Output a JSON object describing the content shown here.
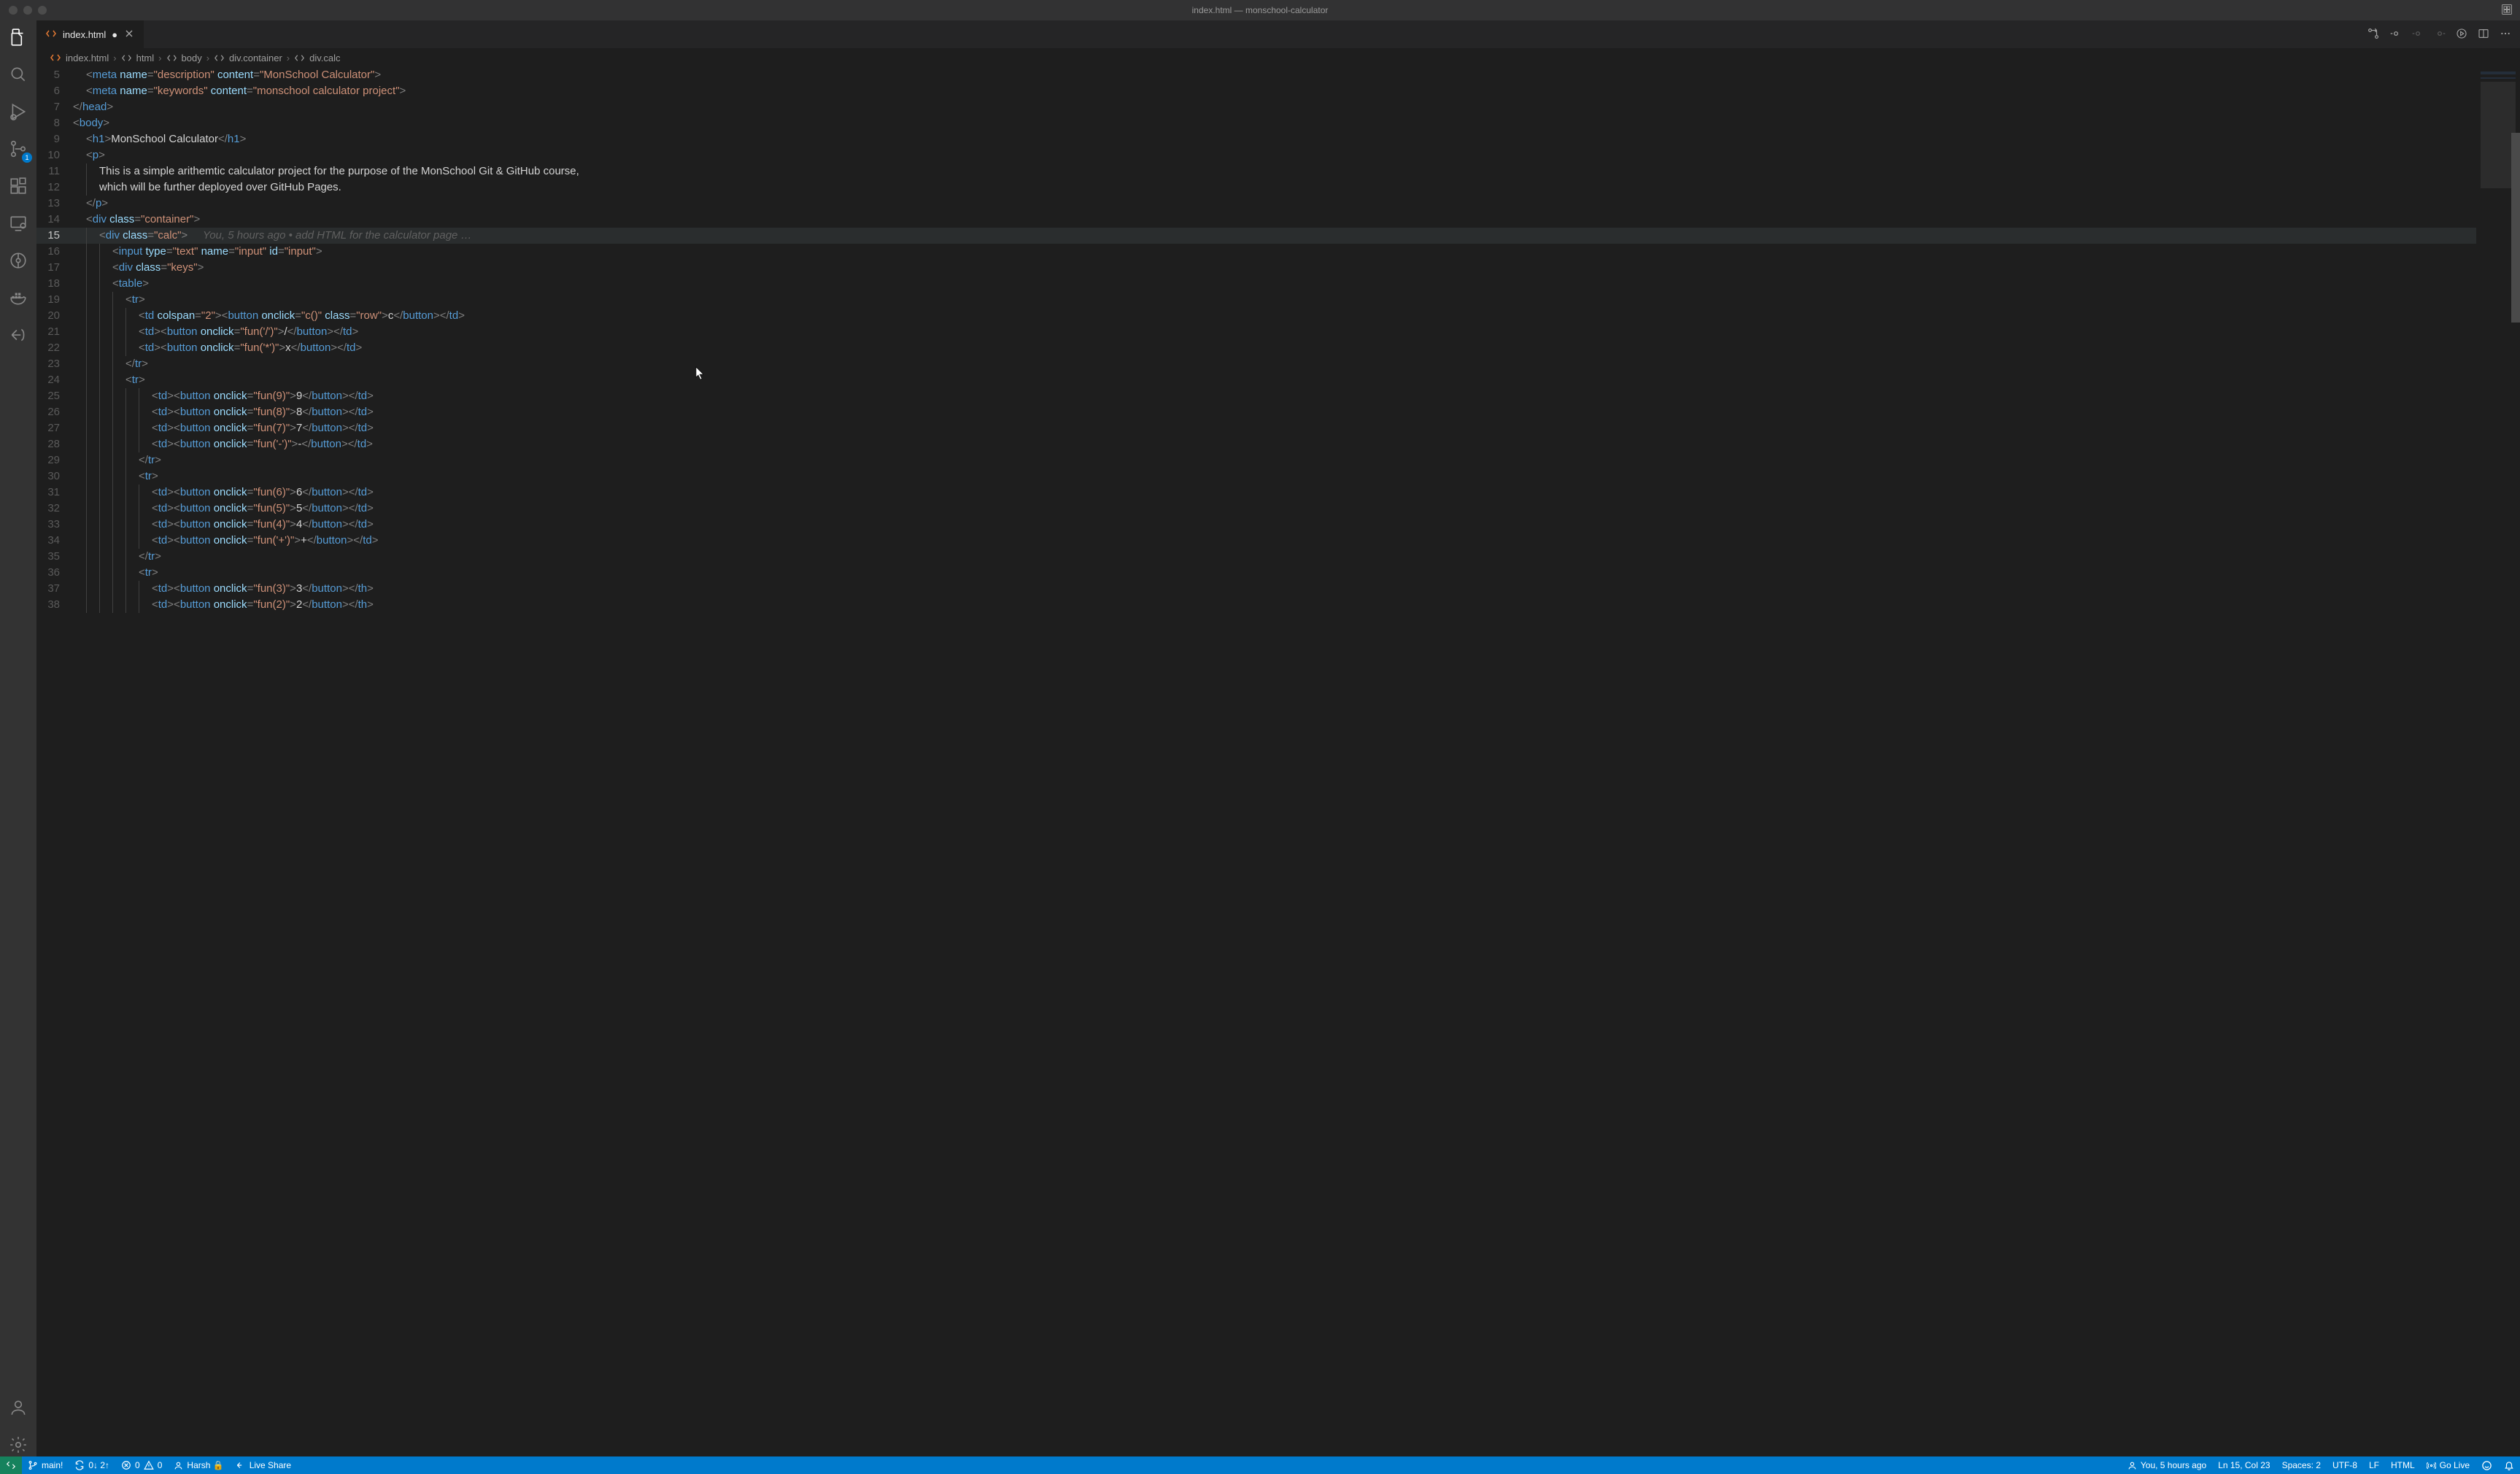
{
  "titlebar": {
    "title": "index.html — monschool-calculator"
  },
  "activitybar": {
    "scm_badge": "1"
  },
  "tab": {
    "filename": "index.html",
    "dirty": "●"
  },
  "breadcrumb": {
    "file": "index.html",
    "p1": "html",
    "p2": "body",
    "p3": "div.container",
    "p4": "div.calc"
  },
  "codelens": "You, 5 hours ago • add HTML for the calculator page …",
  "lines": {
    "l5_text": "MonSchool Calculator",
    "l6_kw": "monschool calculator project",
    "l9_h1": "MonSchool Calculator",
    "l11": "This is a simple arithemtic calculator project for the purpose of the MonSchool Git & GitHub course,",
    "l12": "which will be further deployed over GitHub Pages."
  },
  "statusbar": {
    "branch": "main!",
    "sync": "0↓ 2↑",
    "errors": "0",
    "warnings": "0",
    "user": "Harsh 🔒",
    "liveshare": "Live Share",
    "blame": "You, 5 hours ago",
    "position": "Ln 15, Col 23",
    "spaces": "Spaces: 2",
    "encoding": "UTF-8",
    "eol": "LF",
    "lang": "HTML",
    "golive": "Go Live"
  }
}
